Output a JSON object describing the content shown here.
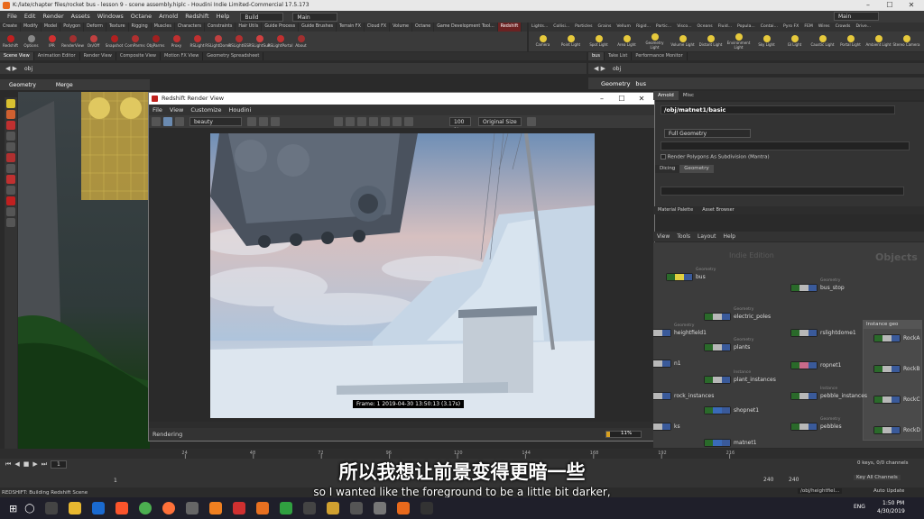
{
  "window": {
    "title": "K:/late/chapter files/rocket bus - lesson 9 - scene assembly.hiplc - Houdini Indie Limited-Commercial 17.5.173"
  },
  "menubar": {
    "items": [
      "File",
      "Edit",
      "Render",
      "Assets",
      "Windows",
      "Octane",
      "Arnold",
      "Redshift",
      "Help"
    ],
    "build": "Build",
    "main": "Main",
    "main_right": "Main"
  },
  "shelf": {
    "tabs": [
      "Create",
      "Modify",
      "Model",
      "Polygon",
      "Deform",
      "Texture",
      "Rigging",
      "Muscles",
      "Characters",
      "Constraints",
      "Hair Utils",
      "Guide Process",
      "Guide Brushes",
      "Terrain FX",
      "Cloud FX",
      "Volume",
      "Octane",
      "Game Development Tool...",
      "Redshift"
    ],
    "tools": [
      "Redshift",
      "Options",
      "IPR",
      "RenderView",
      "On/Off",
      "Snapshot",
      "ComParms",
      "ObjParms",
      "Proxy",
      "RSLight",
      "RSLightDome",
      "RSLightIES",
      "RSLightSun",
      "RSLightPortal",
      "About"
    ]
  },
  "right_shelf": {
    "tabs": [
      "Lights...",
      "Collisi...",
      "Particles",
      "Grains",
      "Vellum",
      "Rigid...",
      "Partic...",
      "Visco...",
      "Oceans",
      "Fluid...",
      "Popula...",
      "Contai...",
      "Pyro FX",
      "FEM",
      "Wires",
      "Crowds",
      "Drive..."
    ],
    "tools": [
      "Camera",
      "Point Light",
      "Spot Light",
      "Area Light",
      "Geometry Light",
      "Volume Light",
      "Distant Light",
      "Environment Light",
      "Sky Light",
      "GI Light",
      "Caustic Light",
      "Portal Light",
      "Ambient Light",
      "Stereo Camera"
    ]
  },
  "left_pane": {
    "tabs": [
      "Scene View",
      "Animation Editor",
      "Render View",
      "Composite View",
      "Motion FX View",
      "Geometry Spreadsheet"
    ],
    "path": "obj",
    "context": "Geometry",
    "node": "Merge"
  },
  "render_view": {
    "title": "Redshift Render View",
    "menu": [
      "File",
      "View",
      "Customize",
      "Houdini"
    ],
    "aov": "beauty",
    "zoom": "100 %",
    "size": "Original Size",
    "frame_info": "Frame: 1  2019-04-30  13:50:13  (3.17s)",
    "status": "Rendering",
    "progress_label": "11%",
    "progress": 0.11
  },
  "right_pane": {
    "top_tabs": [
      "bus",
      "Take List",
      "Performance Monitor"
    ],
    "path": "obj",
    "context": "Geometry",
    "node": "bus",
    "sub_tabs": [
      "Arnold",
      "Misc"
    ],
    "material_path": "/obj/matnet1/basic",
    "geometry_mode": "Full Geometry",
    "subdiv_label": "Render Polygons As Subdivision (Mantra)",
    "dicing_tabs": [
      "Dicing",
      "Geometry"
    ],
    "bottom_tabs": [
      "Material Palette",
      "Asset Browser"
    ],
    "network_menu": [
      "View",
      "Tools",
      "Layout",
      "Help"
    ],
    "edition": "Indie Edition",
    "objects_label": "Objects",
    "instance_group": "Instance geo"
  },
  "nodes": [
    {
      "name": "bus",
      "type": "Geometry",
      "color": "#e0d040"
    },
    {
      "name": "bus_stop",
      "type": "Geometry",
      "color": "#b8b8b8"
    },
    {
      "name": "electric_poles",
      "type": "Geometry",
      "color": "#b8b8b8"
    },
    {
      "name": "heightfield1",
      "type": "Geometry",
      "color": "#b8b8b8"
    },
    {
      "name": "plants",
      "type": "Geometry",
      "color": "#b8b8b8"
    },
    {
      "name": "rslightdome1",
      "type": "",
      "color": "#b8b8b8"
    },
    {
      "name": "ropnet1",
      "type": "",
      "color": "#c86a8a"
    },
    {
      "name": "plant_instances",
      "type": "Instance",
      "color": "#b8b8b8"
    },
    {
      "name": "rock_instances",
      "type": "",
      "color": "#b8b8b8"
    },
    {
      "name": "pebble_instances",
      "type": "Instance",
      "color": "#b8b8b8"
    },
    {
      "name": "shopnet1",
      "type": "",
      "color": "#3a6ab8"
    },
    {
      "name": "pebbles",
      "type": "Geometry",
      "color": "#b8b8b8"
    },
    {
      "name": "matnet1",
      "type": "",
      "color": "#3a6ab8"
    },
    {
      "name": "n1",
      "type": "",
      "color": "#b8b8b8"
    },
    {
      "name": "ks",
      "type": "",
      "color": "#b8b8b8"
    },
    {
      "name": "RockA",
      "type": "",
      "color": "#b8b8b8"
    },
    {
      "name": "RockB",
      "type": "",
      "color": "#b8b8b8"
    },
    {
      "name": "RockC",
      "type": "",
      "color": "#b8b8b8"
    },
    {
      "name": "RockD",
      "type": "",
      "color": "#b8b8b8"
    }
  ],
  "timeline": {
    "frame": "1",
    "start": "1",
    "end_a": "240",
    "end_b": "240",
    "ticks": [
      "24",
      "48",
      "72",
      "96",
      "120",
      "144",
      "168",
      "192",
      "216"
    ],
    "keys_label": "0 keys, 0/0 channels",
    "key_all": "Key All Channels",
    "path_label": "/obj/heightfiel...",
    "auto_update": "Auto Update"
  },
  "status": {
    "text": "REDSHIFT: Building Redshift Scene"
  },
  "subtitles": {
    "cn": "所以我想让前景变得更暗一些",
    "en": "so I wanted like the foreground to be a little bit darker,"
  },
  "taskbar": {
    "time": "1:50 PM",
    "date": "4/30/2019",
    "lang": "ENG"
  }
}
